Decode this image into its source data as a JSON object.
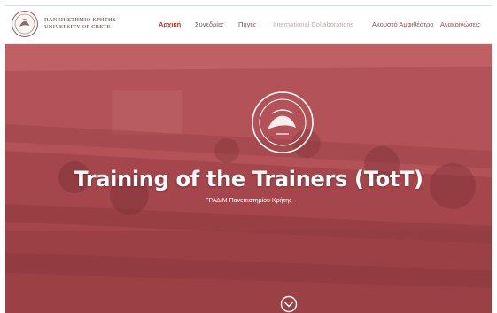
{
  "header": {
    "brand_line1": "ΠΑΝΕΠΙΣΤΗΜΙΟ ΚΡΗΤΗΣ",
    "brand_line2": "UNIVERSITY OF CRETE",
    "nav": [
      {
        "label": "Αρχική",
        "active": true
      },
      {
        "label": "Συνεδρίες",
        "active": false
      },
      {
        "label": "Πηγές",
        "active": false
      },
      {
        "label": "International Collaborations",
        "active": false
      },
      {
        "label": "Ακουστό Αμφιθέατρο",
        "active": false
      },
      {
        "label": "Ανακοινώσεις",
        "active": false
      }
    ]
  },
  "hero": {
    "title": "Training of the Trainers (TotT)",
    "subtitle": "ΓΡΑΔΙΜ Πανεπιστημίου Κρήτης",
    "scroll_icon": "chevron-down-circle-icon"
  },
  "colors": {
    "accent": "#c0392b",
    "hero_overlay": "#a9474c",
    "nav_text": "#8a5555"
  }
}
